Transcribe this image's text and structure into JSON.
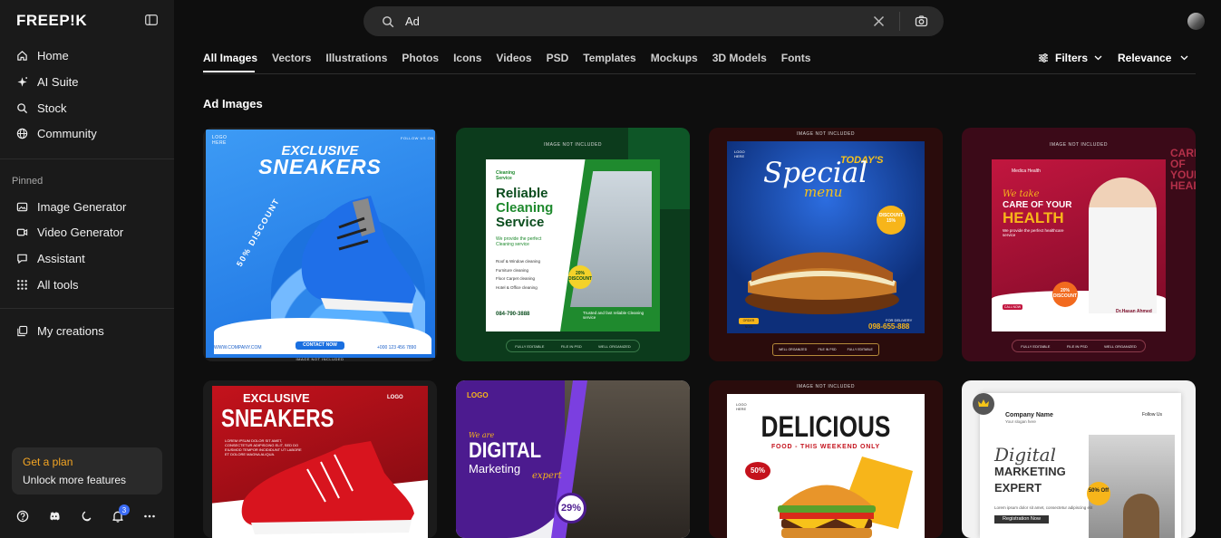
{
  "brand": {
    "logo": "FREEP!K"
  },
  "sidebar": {
    "main": [
      {
        "label": "Home",
        "icon": "home-icon"
      },
      {
        "label": "AI Suite",
        "icon": "sparkle-icon"
      },
      {
        "label": "Stock",
        "icon": "search-icon"
      },
      {
        "label": "Community",
        "icon": "globe-icon"
      }
    ],
    "pinned_label": "Pinned",
    "pinned": [
      {
        "label": "Image Generator",
        "icon": "image-icon"
      },
      {
        "label": "Video Generator",
        "icon": "video-icon"
      },
      {
        "label": "Assistant",
        "icon": "chat-icon"
      },
      {
        "label": "All tools",
        "icon": "grid-icon"
      }
    ],
    "creations": {
      "label": "My creations",
      "icon": "layers-icon"
    },
    "plan": {
      "title": "Get a plan",
      "subtitle": "Unlock more features"
    },
    "notifications_count": "3"
  },
  "search": {
    "value": "Ad",
    "placeholder": ""
  },
  "tabs": [
    "All Images",
    "Vectors",
    "Illustrations",
    "Photos",
    "Icons",
    "Videos",
    "PSD",
    "Templates",
    "Mockups",
    "3D Models",
    "Fonts"
  ],
  "toolbar": {
    "filters_label": "Filters",
    "sort_label": "Relevance"
  },
  "results": {
    "heading": "Ad Images",
    "cards": [
      {
        "title": "EXCLUSIVE",
        "title2": "SNEAKERS",
        "side": "50% DISCOUNT",
        "cta": "CONTACT NOW",
        "web": "WWW.COMPANY.COM",
        "phone": "+000 123 456 7890",
        "logo": "LOGO HERE",
        "follow": "FOLLOW US ON",
        "bottom": "IMAGE NOT INCLUDED",
        "colors": {
          "bg": "#1f7fe8"
        }
      },
      {
        "top": "IMAGE NOT INCLUDED",
        "brand": "Cleaning Service",
        "title": "Reliable",
        "title2": "Cleaning",
        "title3": "Service",
        "sub": "We provide the perfect Cleaning service",
        "list": [
          "Roof & Window cleaning",
          "Furniture cleaning",
          "Floor Carpet cleaning",
          "Hotel & Office cleaning"
        ],
        "badge": "20% DISCOUNT",
        "phone": "084-790-3888",
        "quote": "Trusted and fast reliable Cleaning service",
        "footer": [
          "FULLY EDITABLE",
          "FILE IN PSD",
          "WELL ORGANIZED"
        ]
      },
      {
        "top": "IMAGE NOT INCLUDED",
        "title": "TODAY'S",
        "title2": "Special",
        "title3": "menu",
        "badge": "DISCOUNT 15%",
        "delivery": "FOR DELIVERY",
        "phone": "098-655-888",
        "cta": "ORDER NOW",
        "logo": "LOGO HERE",
        "footer": [
          "WELL ORGANIZED",
          "FILE IN PSD",
          "FULLY EDITABLE"
        ]
      },
      {
        "top": "IMAGE NOT INCLUDED",
        "brand": "Medica Health",
        "title": "We take",
        "title2": "CARE OF YOUR",
        "title3": "HEALTH",
        "sub": "We provide the perfect healthcare service",
        "badge": "20% DISCOUNT",
        "doctor": "Dr.Hasan Ahmed",
        "cta": "CALL NOW",
        "bg_text": "CARE OF YOUR HEALTH",
        "footer": [
          "FULLY EDITABLE",
          "FILE IN PSD",
          "WELL ORGANIZED"
        ]
      },
      {
        "title": "EXCLUSIVE",
        "title2": "SNEAKERS",
        "logo": "LOGO",
        "body": "LOREM IPSUM DOLOR SIT AMET, CONSECTETUR ADIPISCING ELIT, SED DO EIUSMOD TEMPOR INCIDIDUNT UT LABORE ET DOLORE MAGNA ALIQUA."
      },
      {
        "logo": "LOGO",
        "tag": "We are",
        "title": "DIGITAL",
        "title2": "Marketing",
        "title3": "expert",
        "badge": "29%"
      },
      {
        "top": "IMAGE NOT INCLUDED",
        "logo": "LOGO HERE",
        "title": "DELICIOUS",
        "sub": "FOOD - THIS WEEKEND ONLY",
        "badge": "50%"
      },
      {
        "brand": "Company Name",
        "brand_sub": "Your slogan here",
        "follow": "Follow Us",
        "title": "Digital",
        "title2": "MARKETING",
        "title3": "EXPERT",
        "sub": "Lorem ipsum dolor sit amet, consectetur adipiscing elit",
        "cta": "Registration Now",
        "badge": "50% Off"
      }
    ]
  }
}
